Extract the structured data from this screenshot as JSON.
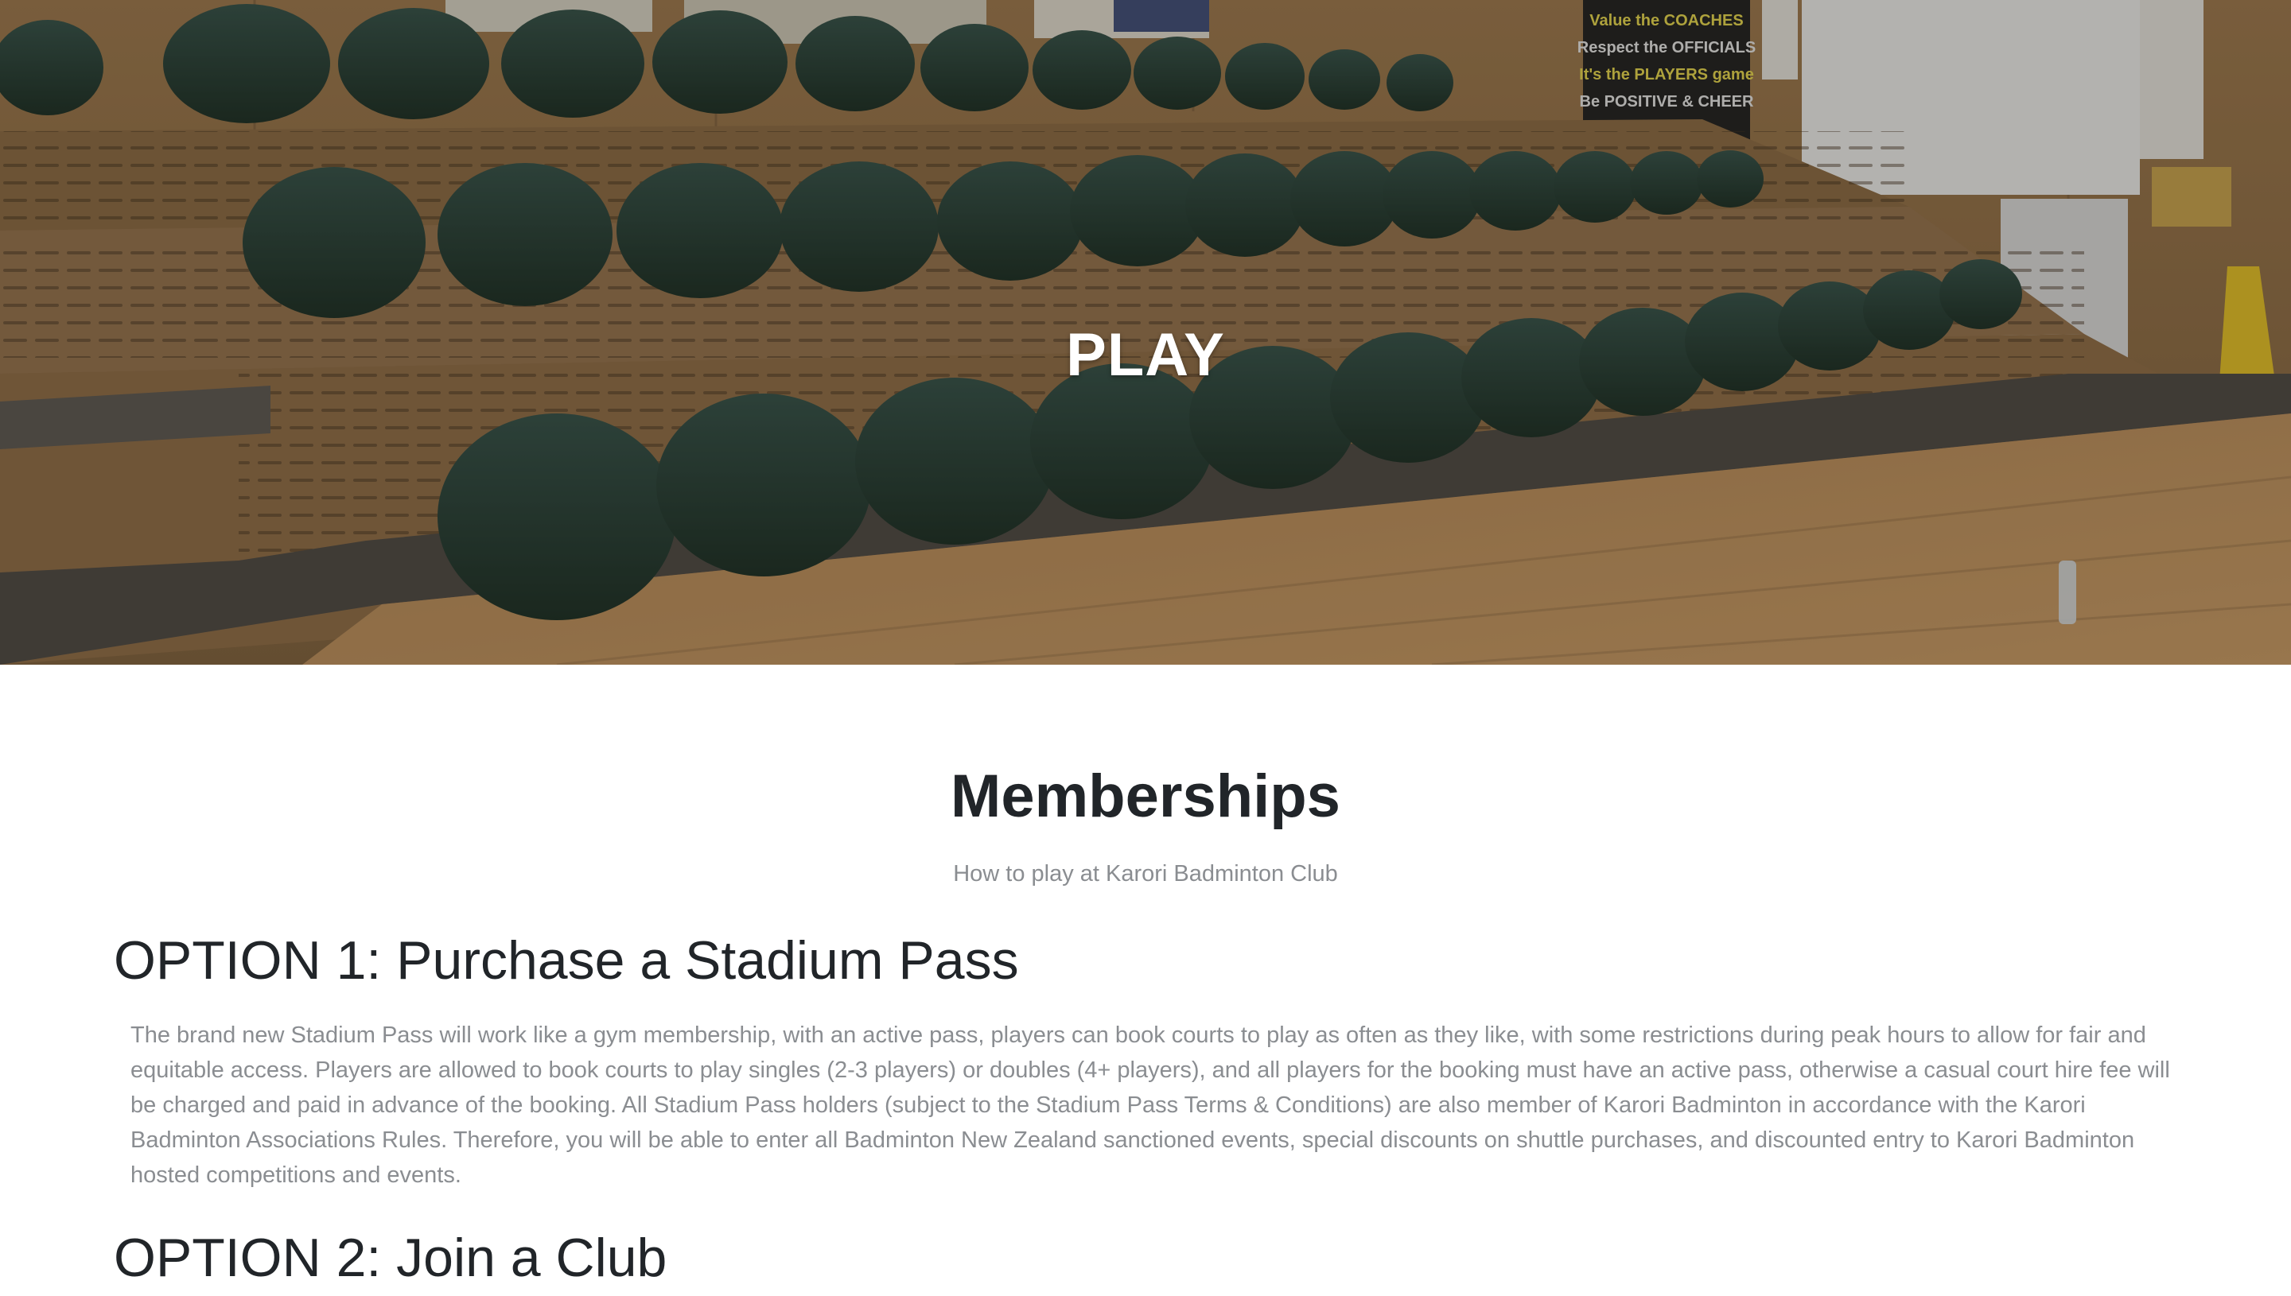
{
  "hero": {
    "title": "PLAY",
    "background_image": "stadium-seating-photo"
  },
  "memberships": {
    "title": "Memberships",
    "subtitle": "How to play at Karori Badminton Club",
    "options": [
      {
        "heading": "OPTION 1: Purchase a Stadium Pass",
        "body": "The brand new Stadium Pass will work like a gym membership, with an active pass, players can book courts to play as often as they like, with some restrictions during peak hours to allow for fair and equitable access. Players are allowed to book courts to play singles (2-3 players) or doubles (4+ players), and all players for the booking must have an active pass, otherwise a casual court hire fee will be charged and paid in advance of the booking. All Stadium Pass holders (subject to the Stadium Pass Terms & Conditions) are also member of Karori Badminton in accordance with the Karori Badminton Associations Rules. Therefore, you will be able to enter all Badminton New Zealand sanctioned events, special discounts on shuttle purchases, and discounted entry to Karori Badminton hosted competitions and events."
      },
      {
        "heading": "OPTION 2: Join a Club"
      }
    ]
  },
  "colors": {
    "heading": "#212529",
    "muted_text": "#8a8d91",
    "hero_text": "#ffffff",
    "seat_green": "#1f3a33",
    "wood": "#a67c4c"
  }
}
